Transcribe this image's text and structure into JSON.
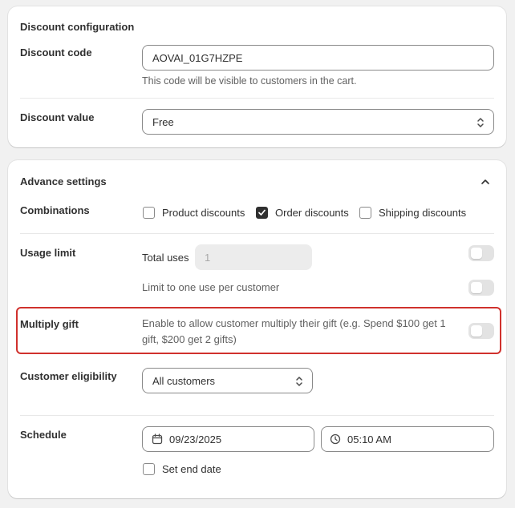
{
  "discount_config": {
    "title": "Discount configuration",
    "code_label": "Discount code",
    "code_value": "AOVAI_01G7HZPE",
    "code_help": "This code will be visible to customers in the cart.",
    "value_label": "Discount value",
    "value_selected": "Free"
  },
  "advance": {
    "title": "Advance settings",
    "combinations": {
      "label": "Combinations",
      "options": [
        {
          "label": "Product discounts",
          "checked": false
        },
        {
          "label": "Order discounts",
          "checked": true
        },
        {
          "label": "Shipping discounts",
          "checked": false
        }
      ]
    },
    "usage_limit": {
      "label": "Usage limit",
      "total_uses_label": "Total uses",
      "total_uses_placeholder": "1",
      "total_uses_enabled": false,
      "one_per_customer_label": "Limit to one use per customer",
      "one_per_customer_enabled": false
    },
    "multiply_gift": {
      "label": "Multiply gift",
      "description": "Enable to allow customer multiply their gift (e.g. Spend $100 get 1 gift, $200 get 2 gifts)",
      "enabled": false
    },
    "eligibility": {
      "label": "Customer eligibility",
      "selected": "All customers"
    },
    "schedule": {
      "label": "Schedule",
      "date": "09/23/2025",
      "time": "05:10 AM",
      "end_date_label": "Set end date",
      "end_date_checked": false
    }
  },
  "colors": {
    "highlight": "#d0312d",
    "toggle_off": "#e3e3e3",
    "checkbox_checked": "#303030"
  }
}
